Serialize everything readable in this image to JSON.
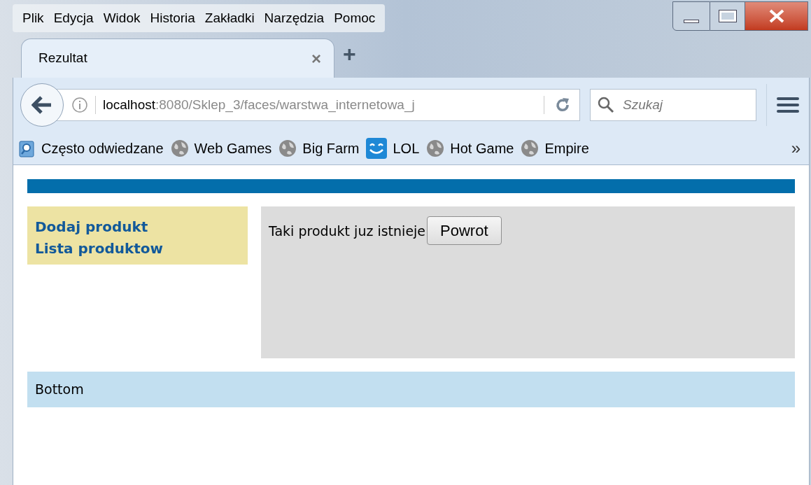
{
  "menu_bar": [
    {
      "label": "Plik"
    },
    {
      "label": "Edycja"
    },
    {
      "label": "Widok"
    },
    {
      "label": "Historia"
    },
    {
      "label": "Zakładki"
    },
    {
      "label": "Narzędzia"
    },
    {
      "label": "Pomoc"
    }
  ],
  "tabs": [
    {
      "label": "Rezultat",
      "selected": true,
      "close": "×"
    }
  ],
  "new_tab": "+",
  "address_bar": {
    "host": "localhost",
    "path": ":8080/Sklep_3/faces/warstwa_internetowa_j"
  },
  "search": {
    "placeholder": "Szukaj"
  },
  "bookmarks": [
    {
      "label": "Często odwiedzane",
      "kind": "folder"
    },
    {
      "label": "Web Games",
      "kind": "globe"
    },
    {
      "label": "Big Farm",
      "kind": "globe"
    },
    {
      "label": "LOL",
      "kind": "smiley"
    },
    {
      "label": "Hot Game",
      "kind": "globe"
    },
    {
      "label": "Empire",
      "kind": "globe"
    }
  ],
  "bookmarks_overflow": "»",
  "page": {
    "sidebar": [
      "Dodaj produkt",
      "Lista produktow"
    ],
    "message": "Taki produkt juz istnieje",
    "button": "Powrot",
    "footer": "Bottom"
  }
}
